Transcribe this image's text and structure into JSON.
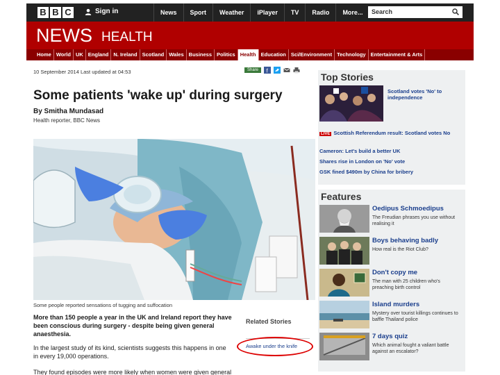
{
  "masthead": {
    "logo_letters": [
      "B",
      "B",
      "C"
    ],
    "sign_in": "Sign in",
    "nav": [
      "News",
      "Sport",
      "Weather",
      "iPlayer",
      "TV",
      "Radio",
      "More..."
    ],
    "search_placeholder": "Search"
  },
  "section": {
    "title": "NEWS",
    "subtitle": "HEALTH",
    "subnav": [
      "Home",
      "World",
      "UK",
      "England",
      "N. Ireland",
      "Scotland",
      "Wales",
      "Business",
      "Politics",
      "Health",
      "Education",
      "Sci/Environment",
      "Technology",
      "Entertainment & Arts"
    ],
    "active": "Health"
  },
  "article": {
    "date_line": "10 September 2014 Last updated at 04:53",
    "share_label": "Share",
    "headline": "Some patients 'wake up' during surgery",
    "byline": "By Smitha Mundasad",
    "role": "Health reporter, BBC News",
    "caption": "Some people reported sensations of tugging and suffocation",
    "p1": "More than 150 people a year in the UK and Ireland report they have been conscious during surgery - despite being given general anaesthesia.",
    "p2": "In the largest study of its kind, scientists suggests this happens in one in every 19,000 operations.",
    "p3": "They found episodes were more likely when women were given general"
  },
  "related": {
    "title": "Related Stories",
    "links": [
      "Awake under the knife"
    ]
  },
  "top_stories": {
    "title": "Top Stories",
    "lead": "Scotland votes 'No' to independence",
    "live_badge": "LIVE",
    "items": [
      "Scottish Referendum result: Scotland votes No",
      "Cameron: Let's build a better UK",
      "Shares rise in London on 'No' vote",
      "GSK fined $490m by China for bribery"
    ]
  },
  "features": {
    "title": "Features",
    "items": [
      {
        "title": "Oedipus Schmoedipus",
        "desc": "The Freudian phrases you use without realising it"
      },
      {
        "title": "Boys behaving badly",
        "desc": "How real is the Riot Club?"
      },
      {
        "title": "Don't copy me",
        "desc": "The man with 25 children who's preaching birth control"
      },
      {
        "title": "Island murders",
        "desc": "Mystery over tourist killings continues to baffle Thailand police"
      },
      {
        "title": "7 days quiz",
        "desc": "Which animal fought a valiant battle against an escalator?"
      }
    ]
  },
  "colors": {
    "news_red": "#b00000",
    "subnav_red": "#8a0000",
    "link_blue": "#1a3e8c",
    "annotation_red": "#dd0000"
  }
}
